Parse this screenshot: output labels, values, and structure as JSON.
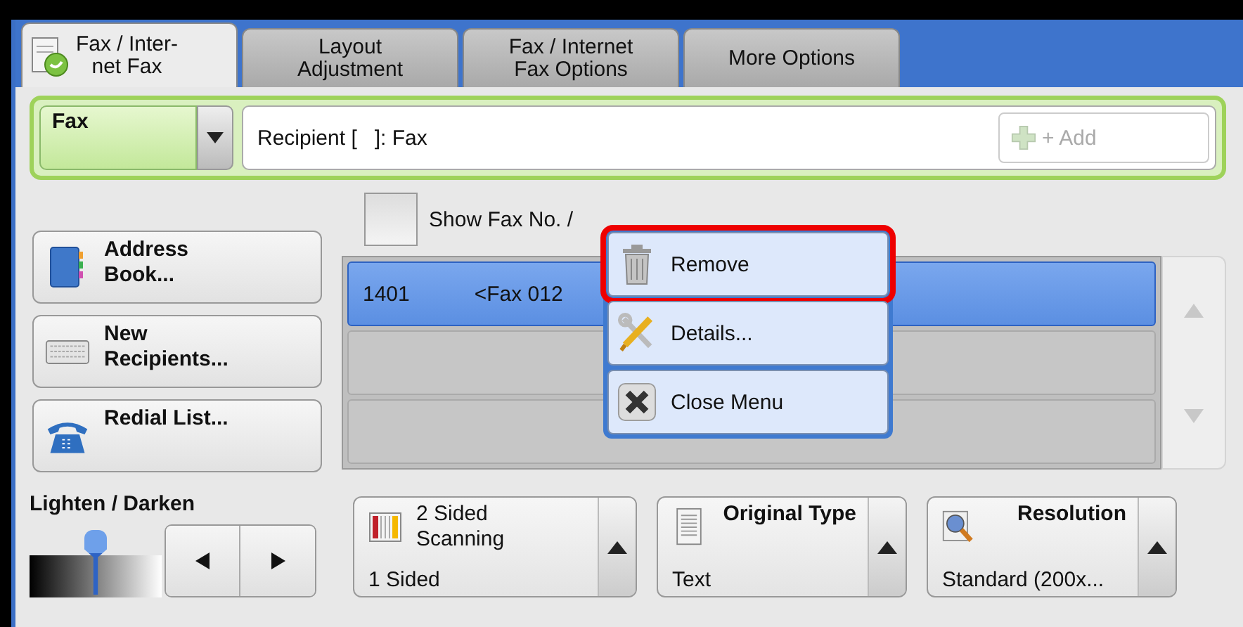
{
  "tabs": [
    {
      "label": "Fax / Inter-\nnet Fax",
      "selected": true
    },
    {
      "label": "Layout\nAdjustment",
      "selected": false
    },
    {
      "label": "Fax / Internet\nFax Options",
      "selected": false
    },
    {
      "label": "More Options",
      "selected": false
    }
  ],
  "recipient_bar": {
    "mode": "Fax",
    "recipient": "Recipient [   ]: Fax",
    "add_button": {
      "label": "+ Add",
      "disabled": true
    }
  },
  "side_buttons": [
    {
      "label": "Address\nBook..."
    },
    {
      "label": "New\nRecipients..."
    },
    {
      "label": "Redial List..."
    }
  ],
  "show_fax_checkbox": {
    "label": "Show Fax No. /",
    "checked": false
  },
  "recipient_list": {
    "rows": [
      {
        "number": "1401",
        "name": "<Fax 012",
        "selected": true
      },
      {
        "number": "",
        "name": "",
        "selected": false
      },
      {
        "number": "",
        "name": "",
        "selected": false
      }
    ]
  },
  "context_menu": [
    {
      "label": "Remove",
      "selected": true
    },
    {
      "label": "Details...",
      "selected": false
    },
    {
      "label": "Close Menu",
      "selected": false
    }
  ],
  "lighten_darken": {
    "label": "Lighten / Darken",
    "level": 0.5
  },
  "features": [
    {
      "title": "2 Sided\nScanning",
      "value": "1 Sided"
    },
    {
      "title": "Original Type",
      "value": "Text"
    },
    {
      "title": "Resolution",
      "value": "Standard (200x..."
    }
  ]
}
